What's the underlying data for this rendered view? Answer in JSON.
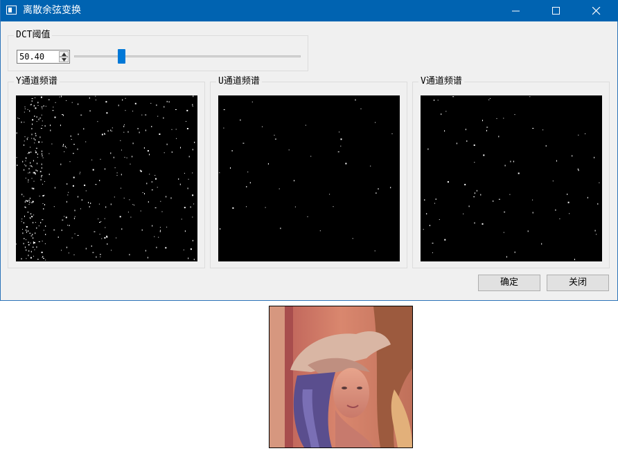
{
  "window": {
    "title": "离散余弦变换"
  },
  "dct": {
    "group_title": "DCT阈值",
    "threshold_value": "50.40",
    "slider_fraction": 0.2
  },
  "panels": [
    {
      "title": "Y通道频谱"
    },
    {
      "title": "U通道频谱"
    },
    {
      "title": "V通道频谱"
    }
  ],
  "buttons": {
    "ok": "确定",
    "close": "关闭"
  },
  "colors": {
    "titlebar": "#0063b1",
    "slider_handle": "#0078d7",
    "spectrum_bg": "#000000"
  },
  "icons": [
    "app-icon",
    "minimize-icon",
    "maximize-icon",
    "close-icon",
    "spin-up-icon",
    "spin-down-icon"
  ]
}
